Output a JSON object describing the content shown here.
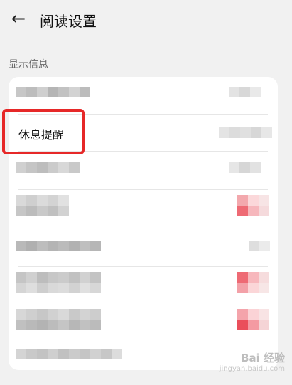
{
  "header": {
    "title": "阅读设置",
    "back_icon": "arrow-left-icon"
  },
  "section": {
    "label": "显示信息"
  },
  "settings": {
    "highlighted_item_label": "休息提醒"
  },
  "colors": {
    "background": "#f1f1f1",
    "card": "#ffffff",
    "highlight_box": "#e62828",
    "toggle_on_pixel": "#ee6a74",
    "blur_gray": "#b9b9b9"
  },
  "watermark": {
    "text": "Bai 经验",
    "subtext": "jingyan.baidu.com"
  }
}
